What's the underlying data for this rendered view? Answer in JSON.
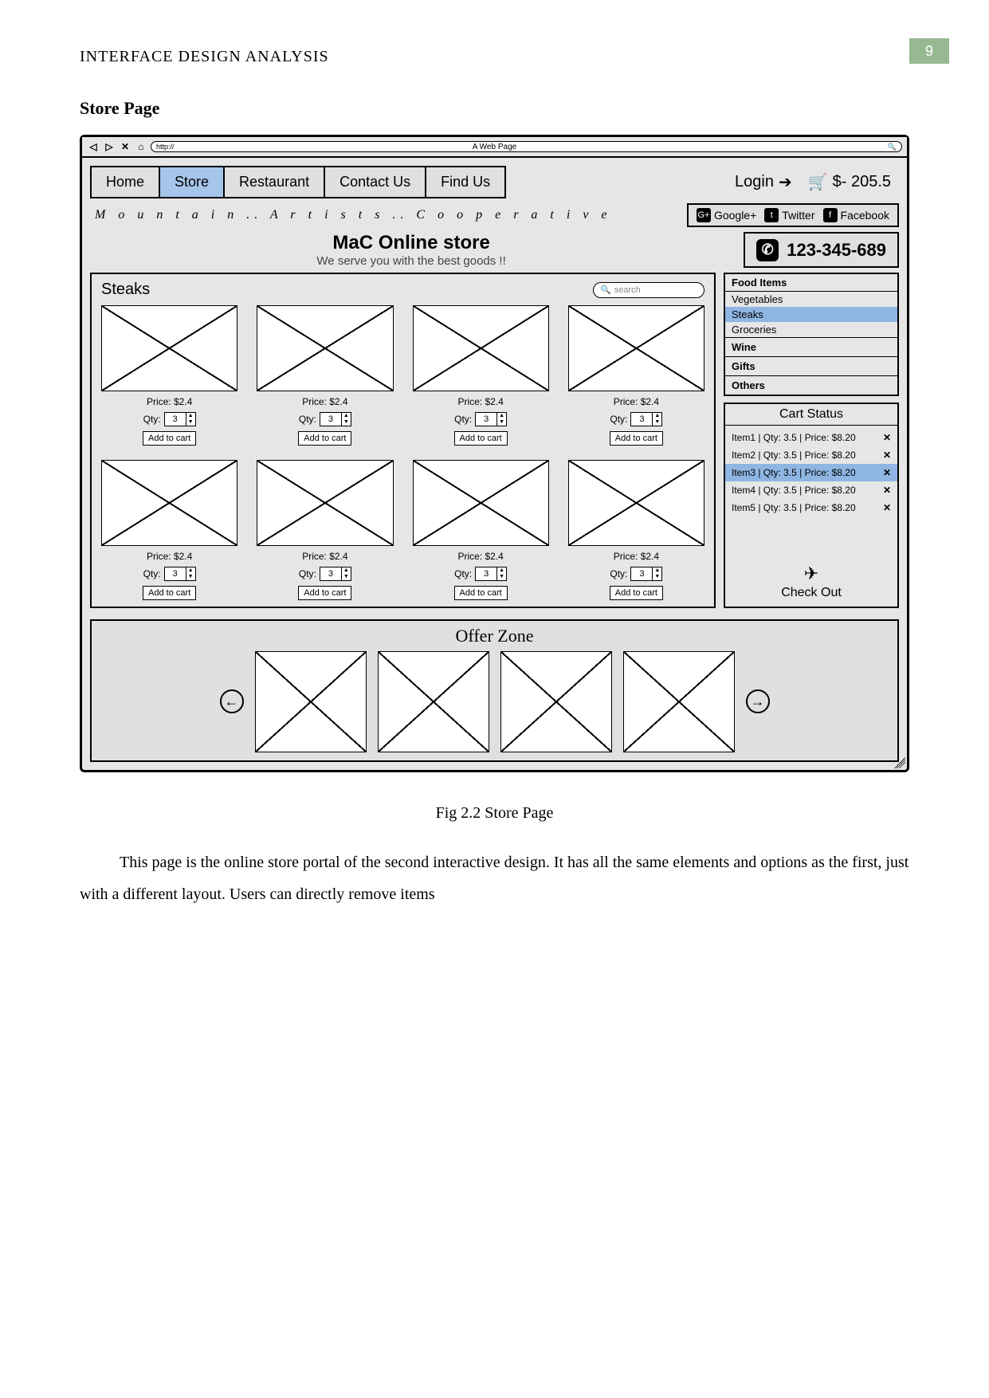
{
  "doc": {
    "running_head": "INTERFACE DESIGN ANALYSIS",
    "page_number": "9",
    "section_title": "Store Page",
    "figure_caption": "Fig 2.2 Store Page",
    "body_paragraph": "This page is the online store portal of the second interactive design. It has all the same elements and options as the first, just with a different layout. Users can directly remove items"
  },
  "browser": {
    "window_title": "A Web Page",
    "url_prefix": "http://"
  },
  "nav": {
    "tabs": [
      {
        "label": "Home",
        "active": false
      },
      {
        "label": "Store",
        "active": true
      },
      {
        "label": "Restaurant",
        "active": false
      },
      {
        "label": "Contact Us",
        "active": false
      },
      {
        "label": "Find Us",
        "active": false
      }
    ],
    "login_label": "Login",
    "cart_total_label": "$- 205.5"
  },
  "brand_line": "M o u n t a i n .. A r t i s t s .. C o o p e r a t i v e",
  "socials": [
    {
      "name": "Google+",
      "badge": "G+"
    },
    {
      "name": "Twitter",
      "badge": "t"
    },
    {
      "name": "Facebook",
      "badge": "f"
    }
  ],
  "store_header": {
    "title": "MaC Online store",
    "subtitle": "We serve you with the best goods !!"
  },
  "phone": "123-345-689",
  "products": {
    "category_title": "Steaks",
    "search_placeholder": "search",
    "price_label": "Price: $2.4",
    "qty_label": "Qty:",
    "qty_value": "3",
    "add_label": "Add to cart",
    "count": 8
  },
  "category_sidebar": {
    "header": "Food Items",
    "items": [
      {
        "label": "Vegetables",
        "selected": false
      },
      {
        "label": "Steaks",
        "selected": true
      },
      {
        "label": "Groceries",
        "selected": false
      }
    ],
    "extra": [
      "Wine",
      "Gifts",
      "Others"
    ]
  },
  "cart": {
    "title": "Cart Status",
    "rows": [
      {
        "text": "Item1 | Qty: 3.5 |  Price: $8.20",
        "selected": false
      },
      {
        "text": "Item2 | Qty: 3.5 |  Price: $8.20",
        "selected": false
      },
      {
        "text": "Item3 | Qty: 3.5 |  Price: $8.20",
        "selected": true
      },
      {
        "text": "Item4 | Qty: 3.5 |  Price: $8.20",
        "selected": false
      },
      {
        "text": "Item5 | Qty: 3.5 |  Price: $8.20",
        "selected": false
      }
    ],
    "checkout_label": "Check Out"
  },
  "offer_zone_title": "Offer Zone"
}
